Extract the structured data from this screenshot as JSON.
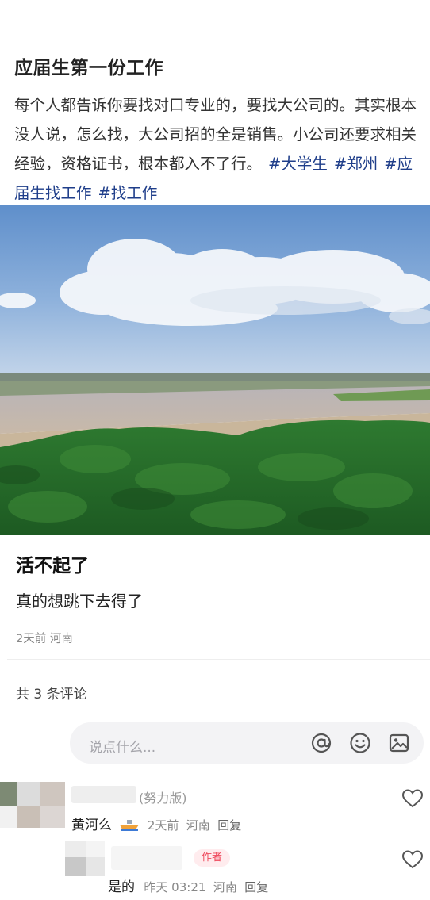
{
  "post": {
    "title": "应届生第一份工作",
    "body": "每个人都告诉你要找对口专业的，要找大公司的。其实根本没人说，怎么找，大公司招的全是销售。小公司还要求相关经验，资格证书，根本都入不了行。",
    "tags": [
      "#大学生",
      "#郑州",
      "#应届生找工作",
      "#找工作"
    ]
  },
  "sub_post": {
    "title": "活不起了",
    "body": "真的想跳下去得了",
    "meta": "2天前 河南"
  },
  "comments_section": {
    "count_label": "共 3 条评论",
    "input_placeholder": "说点什么...",
    "input_icons": [
      "at-icon",
      "emoji-icon",
      "image-icon"
    ]
  },
  "comments": [
    {
      "username_suffix": "(努力版)",
      "text": "黄河么",
      "emoji": "boat-icon",
      "time": "2天前",
      "location": "河南",
      "reply_label": "回复"
    },
    {
      "badge": "作者",
      "text": "是的",
      "time": "昨天 03:21",
      "location": "河南",
      "reply_label": "回复"
    }
  ],
  "colors": {
    "hashtag": "#1f3e8a",
    "author_badge_bg": "#ffecee",
    "author_badge_text": "#ef4a5d",
    "meta": "#888888"
  }
}
